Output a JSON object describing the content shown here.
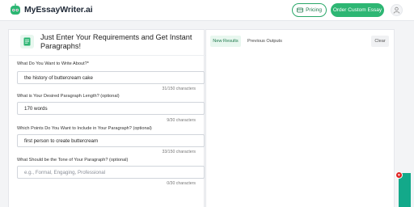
{
  "header": {
    "brand": "MyEssayWriter.ai",
    "pricing_label": "Pricing",
    "order_label": "Order Custom Essay"
  },
  "form": {
    "title": "Just Enter Your Requirements and Get Instant Paragraphs!",
    "topic": {
      "label": "What Do You Want to Write About?*",
      "value": "the history of buttercream cake",
      "counter": "31/150 characters"
    },
    "length": {
      "label": "What is Your Desired Paragraph Length? (optional)",
      "value": "170 words",
      "counter": "9/30 characters"
    },
    "points": {
      "label": "Which Points Do You Want to Include in Your Paragraph? (optional)",
      "value": "first person to create buttercream",
      "counter": "33/150 characters"
    },
    "tone": {
      "label": "What Should be the Tone of Your Paragraph? (optional)",
      "placeholder": "e.g., Formal, Engaging, Professional",
      "counter": "0/30 characters"
    }
  },
  "results": {
    "tabs": [
      "New Results",
      "Previous Outputs"
    ],
    "active_tab": "New Results",
    "clear_label": "Clear"
  },
  "widget": {
    "badge_icon": "heart-icon"
  },
  "colors": {
    "accent": "#2db673",
    "accent_light": "#e8f7ef",
    "widget": "#13a98a",
    "badge": "#e02424"
  }
}
